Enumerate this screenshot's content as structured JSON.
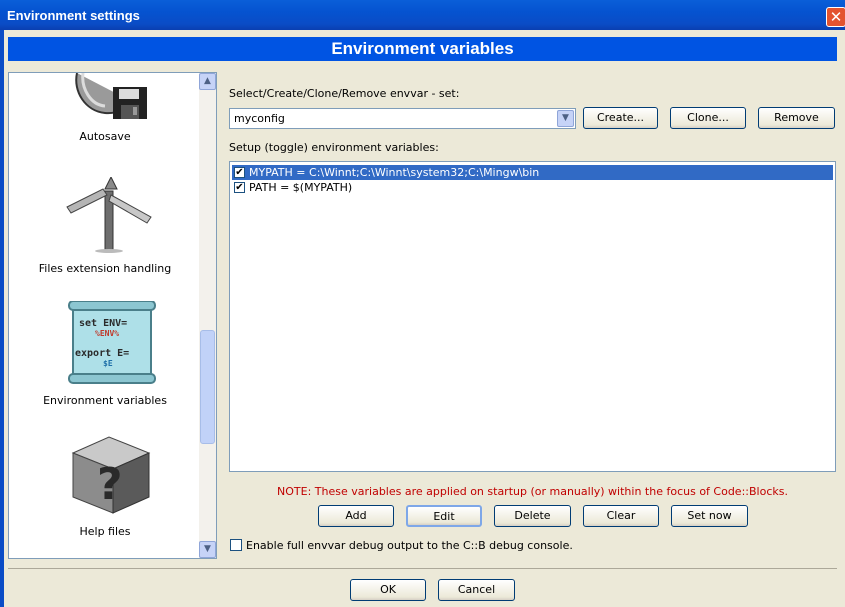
{
  "window": {
    "title": "Environment settings",
    "close_icon": "close-icon"
  },
  "header": {
    "title": "Environment variables"
  },
  "sidebar": {
    "items": [
      {
        "label": "Autosave",
        "icon": "autosave-icon"
      },
      {
        "label": "Files extension handling",
        "icon": "file-extension-icon"
      },
      {
        "label": "Environment variables",
        "icon": "envvars-scroll-icon",
        "icon_lines": [
          "set ENV=",
          "%ENV%",
          "export E=",
          "$E"
        ]
      },
      {
        "label": "Help files",
        "icon": "help-files-icon"
      }
    ]
  },
  "envset": {
    "label": "Select/Create/Clone/Remove envvar - set:",
    "selected": "myconfig",
    "create_label": "Create...",
    "clone_label": "Clone...",
    "remove_label": "Remove"
  },
  "vars": {
    "label": "Setup (toggle) environment variables:",
    "items": [
      {
        "text": "MYPATH = C:\\Winnt;C:\\Winnt\\system32;C:\\Mingw\\bin",
        "checked": true,
        "selected": true
      },
      {
        "text": "PATH = $(MYPATH)",
        "checked": true,
        "selected": false
      }
    ],
    "note": "NOTE: These variables are applied on startup (or manually) within the focus of Code::Blocks.",
    "add_label": "Add",
    "edit_label": "Edit",
    "delete_label": "Delete",
    "clear_label": "Clear",
    "setnow_label": "Set now"
  },
  "debug": {
    "label": "Enable full envvar debug output to the C::B debug console.",
    "checked": false
  },
  "footer": {
    "ok_label": "OK",
    "cancel_label": "Cancel"
  },
  "colors": {
    "title_bar": "#0a4cc6",
    "header_bg": "#0054e3",
    "selection": "#316ac5",
    "note": "#c00000"
  }
}
